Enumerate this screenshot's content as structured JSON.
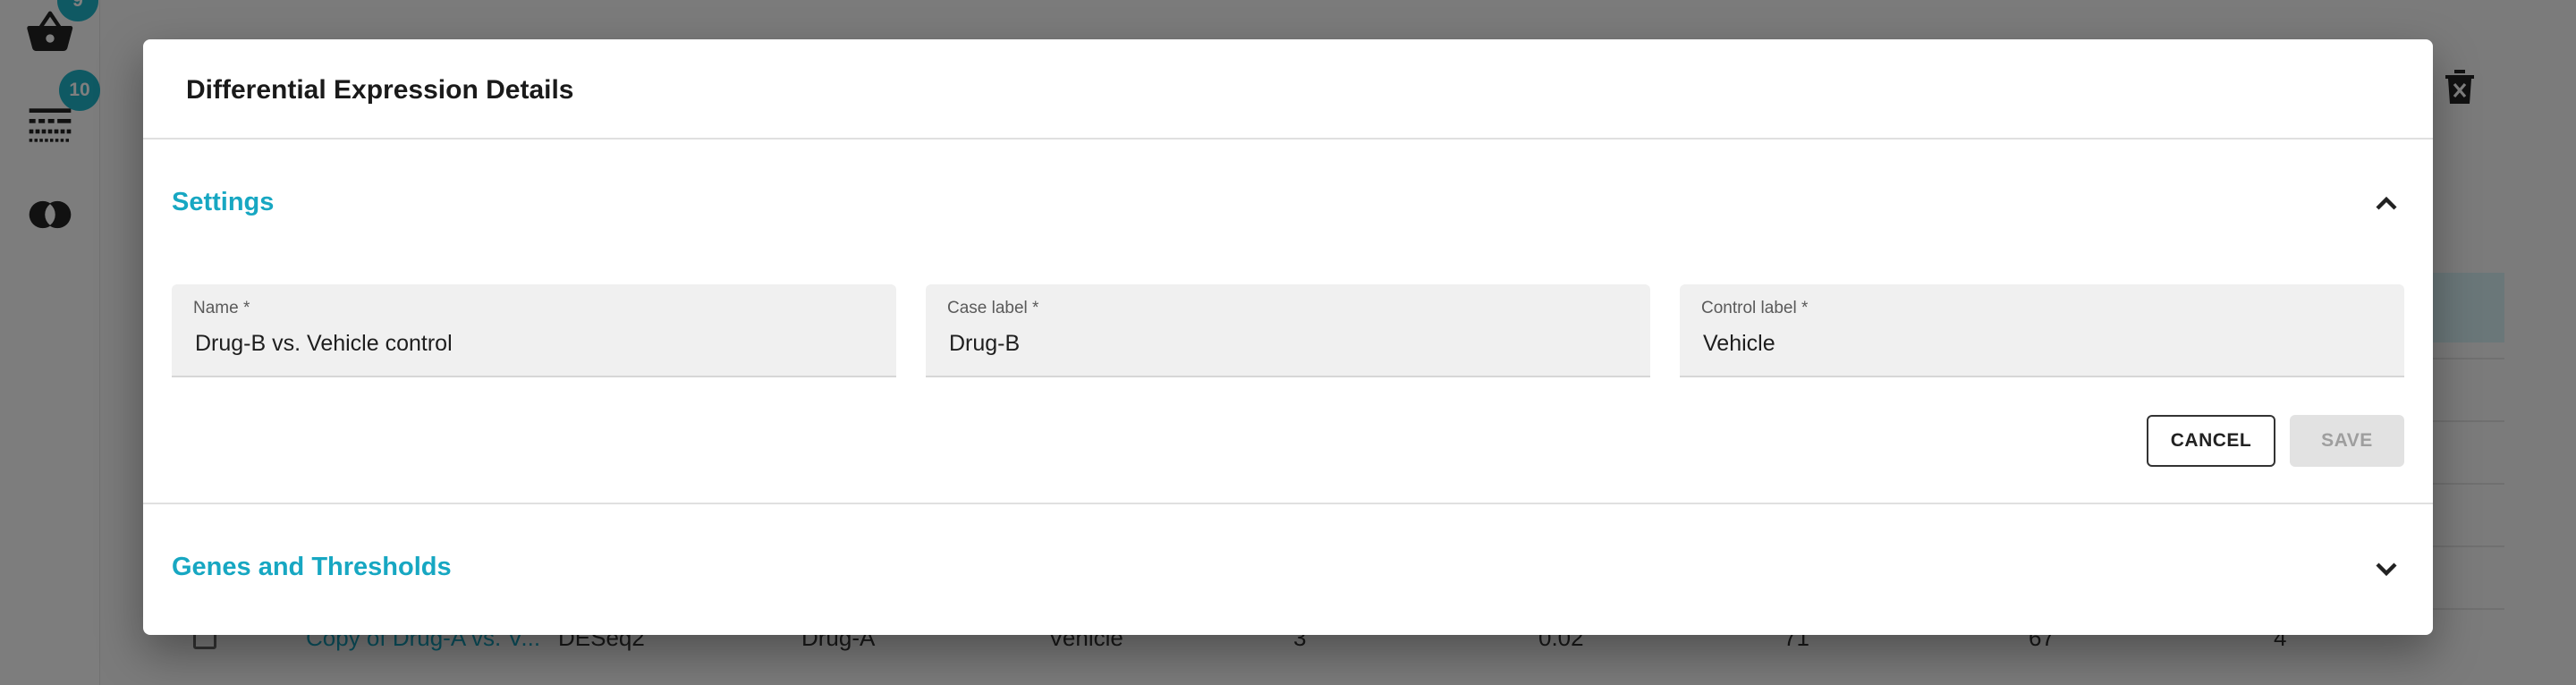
{
  "rail": {
    "badge1": "9",
    "badge2": "10"
  },
  "background_row": {
    "name": "Copy of Drug-A vs. V...",
    "method": "DESeq2",
    "case": "Drug-A",
    "control": "Vehicle",
    "col1": "3",
    "col2": "0.02",
    "col3": "71",
    "col4": "67",
    "col5": "4"
  },
  "dialog": {
    "title": "Differential Expression Details",
    "settings": {
      "title": "Settings",
      "expanded": true,
      "fields": {
        "name": {
          "label": "Name *",
          "value": "Drug-B vs. Vehicle control"
        },
        "case_label": {
          "label": "Case label *",
          "value": "Drug-B"
        },
        "control_label": {
          "label": "Control label *",
          "value": "Vehicle"
        }
      },
      "cancel_label": "CANCEL",
      "save_label": "SAVE"
    },
    "genes": {
      "title": "Genes and Thresholds",
      "expanded": false
    }
  },
  "colors": {
    "accent": "#17a7c2",
    "badge": "#1fb2c6"
  },
  "icons": [
    "basket-icon",
    "filter-list-icon",
    "venn-icon",
    "delete-icon",
    "chevron-up-icon",
    "chevron-down-icon"
  ]
}
